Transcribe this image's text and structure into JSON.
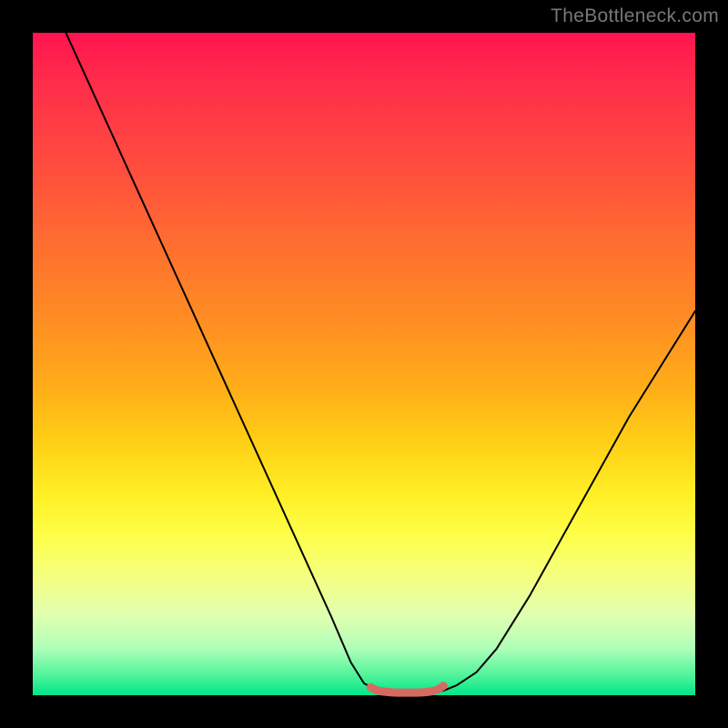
{
  "watermark": "TheBottleneck.com",
  "chart_data": {
    "type": "line",
    "title": "",
    "xlabel": "",
    "ylabel": "",
    "xlim": [
      0,
      100
    ],
    "ylim": [
      0,
      100
    ],
    "series": [
      {
        "name": "left-curve",
        "stroke": "#000000",
        "stroke_width": 2,
        "x": [
          5,
          10,
          15,
          20,
          25,
          30,
          35,
          40,
          45,
          48,
          50,
          52,
          54
        ],
        "values": [
          100,
          89,
          78,
          67,
          56,
          45,
          34,
          23,
          12,
          5,
          1.8,
          0.7,
          0.4
        ]
      },
      {
        "name": "right-curve",
        "stroke": "#000000",
        "stroke_width": 2,
        "x": [
          60,
          62,
          64,
          67,
          70,
          75,
          80,
          85,
          90,
          95,
          100
        ],
        "values": [
          0.4,
          0.7,
          1.5,
          3.5,
          7,
          15,
          24,
          33,
          42,
          50,
          58
        ]
      },
      {
        "name": "flat-bottom-highlight",
        "stroke": "#d66a63",
        "stroke_width": 9,
        "x": [
          51,
          52,
          53,
          54,
          55,
          56,
          57,
          58,
          59,
          60,
          61,
          62
        ],
        "values": [
          1.2,
          0.7,
          0.55,
          0.45,
          0.4,
          0.4,
          0.4,
          0.4,
          0.45,
          0.55,
          0.8,
          1.4
        ]
      }
    ],
    "colors": {
      "gradient_top": "#ff1450",
      "gradient_mid": "#fff026",
      "gradient_bottom": "#00e688",
      "highlight": "#d66a63",
      "curve": "#000000",
      "frame": "#000000"
    }
  }
}
